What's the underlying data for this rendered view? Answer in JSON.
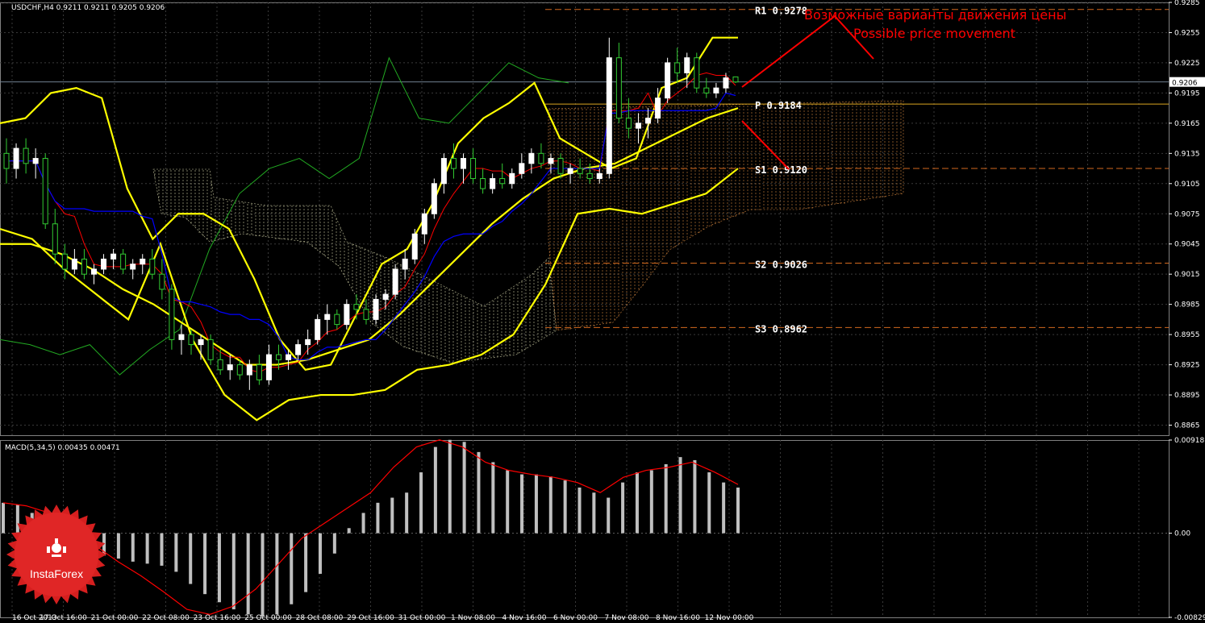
{
  "window": {
    "symbol_header": "USDCHF,H4  0.9211 0.9211 0.9205 0.9206",
    "macd_header": "MACD(5,34,5) 0.00435 0.00471",
    "current_price_tag": "0.9206"
  },
  "annotation": {
    "line1": "Возможные варианты движения цены",
    "line2": "Possible price movement"
  },
  "logo": {
    "name": "InstaForex"
  },
  "colors": {
    "background": "#000000",
    "grid": "#3a3a3a",
    "bull": "#ffffff",
    "bear": "#33cc33",
    "bollinger": "#ffff00",
    "tenkan": "#ff0000",
    "kijun": "#0000ff",
    "chikou": "#22aa22",
    "level_line": "#d2691e",
    "pivot_line": "#daa520",
    "arrows": "#ff0000",
    "macd_hist": "#c0c0c0",
    "macd_signal": "#ff0000"
  },
  "chart_data": [
    {
      "type": "candlestick",
      "title": "USDCHF,H4",
      "ylim": [
        0.8855,
        0.9285
      ],
      "y_ticks": [
        "0.9285",
        "0.9255",
        "0.9225",
        "0.9195",
        "0.9165",
        "0.9135",
        "0.9105",
        "0.9075",
        "0.9045",
        "0.9015",
        "0.8985",
        "0.8955",
        "0.8925",
        "0.8895",
        "0.8865"
      ],
      "x_ticks": [
        "16 Oct 2013",
        "17 Oct 16:00",
        "21 Oct 00:00",
        "22 Oct 08:00",
        "23 Oct 16:00",
        "25 Oct 00:00",
        "28 Oct 08:00",
        "29 Oct 16:00",
        "31 Oct 00:00",
        "1 Nov 08:00",
        "4 Nov 16:00",
        "6 Nov 00:00",
        "7 Nov 08:00",
        "8 Nov 16:00",
        "12 Nov 00:00"
      ],
      "pivot_levels": [
        {
          "label": "R1 0.9278",
          "value": 0.9278
        },
        {
          "label": "P 0.9184",
          "value": 0.9184
        },
        {
          "label": "S1 0.9120",
          "value": 0.912
        },
        {
          "label": "S2 0.9026",
          "value": 0.9026
        },
        {
          "label": "S3 0.8962",
          "value": 0.8962
        }
      ],
      "last_price": 0.9206,
      "candles": [
        [
          0.9135,
          0.915,
          0.9105,
          0.912
        ],
        [
          0.912,
          0.9145,
          0.911,
          0.914
        ],
        [
          0.914,
          0.915,
          0.9115,
          0.9125
        ],
        [
          0.9125,
          0.914,
          0.911,
          0.913
        ],
        [
          0.913,
          0.9135,
          0.906,
          0.9065
        ],
        [
          0.9065,
          0.908,
          0.9025,
          0.9035
        ],
        [
          0.9035,
          0.9045,
          0.901,
          0.902
        ],
        [
          0.902,
          0.904,
          0.9015,
          0.903
        ],
        [
          0.903,
          0.904,
          0.901,
          0.9015
        ],
        [
          0.9015,
          0.9025,
          0.9005,
          0.902
        ],
        [
          0.902,
          0.9035,
          0.9015,
          0.903
        ],
        [
          0.903,
          0.904,
          0.902,
          0.9035
        ],
        [
          0.9035,
          0.904,
          0.9015,
          0.902
        ],
        [
          0.902,
          0.903,
          0.901,
          0.9025
        ],
        [
          0.9025,
          0.9035,
          0.9015,
          0.903
        ],
        [
          0.903,
          0.904,
          0.901,
          0.9015
        ],
        [
          0.9015,
          0.903,
          0.899,
          0.9
        ],
        [
          0.9,
          0.9005,
          0.894,
          0.895
        ],
        [
          0.895,
          0.8965,
          0.8935,
          0.8955
        ],
        [
          0.8955,
          0.896,
          0.8935,
          0.8945
        ],
        [
          0.8945,
          0.8955,
          0.893,
          0.895
        ],
        [
          0.895,
          0.8955,
          0.8925,
          0.893
        ],
        [
          0.893,
          0.894,
          0.8915,
          0.892
        ],
        [
          0.892,
          0.8935,
          0.891,
          0.8925
        ],
        [
          0.8925,
          0.893,
          0.891,
          0.8915
        ],
        [
          0.8915,
          0.893,
          0.89,
          0.8925
        ],
        [
          0.8925,
          0.8935,
          0.8905,
          0.891
        ],
        [
          0.891,
          0.8945,
          0.8905,
          0.8935
        ],
        [
          0.8935,
          0.8945,
          0.892,
          0.893
        ],
        [
          0.893,
          0.894,
          0.892,
          0.8935
        ],
        [
          0.8935,
          0.895,
          0.893,
          0.8945
        ],
        [
          0.8945,
          0.896,
          0.8935,
          0.895
        ],
        [
          0.895,
          0.8975,
          0.8945,
          0.897
        ],
        [
          0.897,
          0.8985,
          0.8955,
          0.8975
        ],
        [
          0.8975,
          0.898,
          0.896,
          0.8965
        ],
        [
          0.8965,
          0.899,
          0.896,
          0.8985
        ],
        [
          0.8985,
          0.8995,
          0.897,
          0.898
        ],
        [
          0.898,
          0.899,
          0.8965,
          0.897
        ],
        [
          0.897,
          0.8995,
          0.8965,
          0.899
        ],
        [
          0.899,
          0.9,
          0.898,
          0.8995
        ],
        [
          0.8995,
          0.9025,
          0.899,
          0.902
        ],
        [
          0.902,
          0.904,
          0.901,
          0.903
        ],
        [
          0.903,
          0.906,
          0.9025,
          0.9055
        ],
        [
          0.9055,
          0.908,
          0.9045,
          0.9075
        ],
        [
          0.9075,
          0.911,
          0.907,
          0.9105
        ],
        [
          0.9105,
          0.9135,
          0.9095,
          0.913
        ],
        [
          0.913,
          0.9145,
          0.911,
          0.912
        ],
        [
          0.912,
          0.9135,
          0.9105,
          0.913
        ],
        [
          0.913,
          0.914,
          0.9105,
          0.911
        ],
        [
          0.911,
          0.912,
          0.9095,
          0.91
        ],
        [
          0.91,
          0.9115,
          0.9095,
          0.911
        ],
        [
          0.911,
          0.9125,
          0.91,
          0.9105
        ],
        [
          0.9105,
          0.912,
          0.91,
          0.9115
        ],
        [
          0.9115,
          0.9135,
          0.911,
          0.9125
        ],
        [
          0.9125,
          0.914,
          0.9115,
          0.9135
        ],
        [
          0.9135,
          0.9145,
          0.912,
          0.9125
        ],
        [
          0.9125,
          0.9135,
          0.9115,
          0.913
        ],
        [
          0.913,
          0.9135,
          0.911,
          0.9115
        ],
        [
          0.9115,
          0.9125,
          0.9105,
          0.912
        ],
        [
          0.912,
          0.913,
          0.911,
          0.9115
        ],
        [
          0.9115,
          0.9125,
          0.9105,
          0.911
        ],
        [
          0.911,
          0.912,
          0.9105,
          0.9115
        ],
        [
          0.9115,
          0.925,
          0.911,
          0.923
        ],
        [
          0.923,
          0.9245,
          0.9165,
          0.917
        ],
        [
          0.917,
          0.919,
          0.915,
          0.916
        ],
        [
          0.916,
          0.9175,
          0.9145,
          0.9165
        ],
        [
          0.9165,
          0.918,
          0.915,
          0.917
        ],
        [
          0.917,
          0.92,
          0.9165,
          0.919
        ],
        [
          0.919,
          0.923,
          0.9185,
          0.9225
        ],
        [
          0.9225,
          0.924,
          0.9205,
          0.9215
        ],
        [
          0.9215,
          0.9235,
          0.92,
          0.923
        ],
        [
          0.923,
          0.9235,
          0.9195,
          0.92
        ],
        [
          0.92,
          0.921,
          0.919,
          0.9195
        ],
        [
          0.9195,
          0.9205,
          0.919,
          0.92
        ],
        [
          0.92,
          0.9215,
          0.9195,
          0.921
        ],
        [
          0.9211,
          0.9211,
          0.9205,
          0.9206
        ]
      ],
      "bollinger_upper": [
        0.9165,
        0.917,
        0.9195,
        0.92,
        0.919,
        0.91,
        0.905,
        0.9075,
        0.9075,
        0.906,
        0.901,
        0.895,
        0.892,
        0.8925,
        0.8975,
        0.9025,
        0.904,
        0.9085,
        0.9145,
        0.917,
        0.9185,
        0.9205,
        0.915,
        0.9135,
        0.912,
        0.913,
        0.92,
        0.921,
        0.925,
        0.925
      ],
      "bollinger_mid": [
        0.9045,
        0.9045,
        0.9035,
        0.902,
        0.9,
        0.8985,
        0.8965,
        0.8945,
        0.8925,
        0.8925,
        0.893,
        0.894,
        0.895,
        0.8975,
        0.9005,
        0.9035,
        0.9065,
        0.909,
        0.911,
        0.912,
        0.9125,
        0.914,
        0.9155,
        0.917,
        0.918
      ],
      "bollinger_lower": [
        0.906,
        0.905,
        0.902,
        0.8995,
        0.897,
        0.9045,
        0.895,
        0.8895,
        0.887,
        0.889,
        0.8895,
        0.8895,
        0.89,
        0.892,
        0.8925,
        0.8935,
        0.8955,
        0.9005,
        0.9075,
        0.908,
        0.9075,
        0.9085,
        0.9095,
        0.912
      ],
      "chikou_span": [
        0.895,
        0.8945,
        0.8935,
        0.8945,
        0.8915,
        0.894,
        0.896,
        0.904,
        0.9095,
        0.912,
        0.913,
        0.911,
        0.913,
        0.923,
        0.917,
        0.9165,
        0.9195,
        0.9225,
        0.921,
        0.9205
      ]
    },
    {
      "type": "bar",
      "title": "MACD(5,34,5)",
      "ylim": [
        -0.00829,
        0.00918
      ],
      "y_ticks": [
        "0.00918",
        "0.00",
        "-0.00829"
      ],
      "macd_values": [
        0.003,
        0.0028,
        0.002,
        0.001,
        -0.0005,
        -0.0012,
        -0.0018,
        -0.0022,
        -0.0025,
        -0.0028,
        -0.003,
        -0.0032,
        -0.0038,
        -0.005,
        -0.006,
        -0.0068,
        -0.0075,
        -0.008,
        -0.0082,
        -0.008,
        -0.007,
        -0.0058,
        -0.004,
        -0.002,
        0.0005,
        0.002,
        0.003,
        0.0035,
        0.004,
        0.006,
        0.0085,
        0.0092,
        0.009,
        0.008,
        0.007,
        0.0062,
        0.0058,
        0.0058,
        0.0056,
        0.0052,
        0.0045,
        0.004,
        0.0035,
        0.005,
        0.006,
        0.0062,
        0.0068,
        0.0075,
        0.0072,
        0.006,
        0.005,
        0.0045
      ],
      "signal_values": [
        0.003,
        0.0027,
        0.002,
        0.0008,
        -0.0012,
        -0.0028,
        -0.0042,
        -0.0058,
        -0.0075,
        -0.008,
        -0.0072,
        -0.0055,
        -0.003,
        -0.0005,
        0.001,
        0.0025,
        0.004,
        0.0065,
        0.0085,
        0.0092,
        0.0085,
        0.007,
        0.0062,
        0.0058,
        0.0055,
        0.005,
        0.004,
        0.0055,
        0.0062,
        0.0065,
        0.007,
        0.006,
        0.0048
      ]
    }
  ]
}
